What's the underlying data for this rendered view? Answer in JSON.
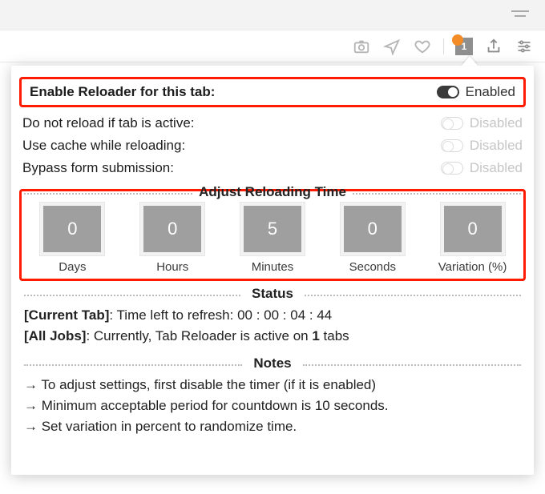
{
  "toolbar": {
    "badge_count": "1"
  },
  "options": {
    "enable_label": "Enable Reloader for this tab:",
    "enable_state": "Enabled",
    "no_reload_active_label": "Do not reload if tab is active:",
    "no_reload_active_state": "Disabled",
    "use_cache_label": "Use cache while reloading:",
    "use_cache_state": "Disabled",
    "bypass_form_label": "Bypass form submission:",
    "bypass_form_state": "Disabled"
  },
  "sections": {
    "adjust": "Adjust Reloading Time",
    "status": "Status",
    "notes": "Notes"
  },
  "time": {
    "days": {
      "value": "0",
      "label": "Days"
    },
    "hours": {
      "value": "0",
      "label": "Hours"
    },
    "minutes": {
      "value": "5",
      "label": "Minutes"
    },
    "seconds": {
      "value": "0",
      "label": "Seconds"
    },
    "variation": {
      "value": "0",
      "label": "Variation (%)"
    }
  },
  "status": {
    "current_prefix": "[Current Tab]",
    "current_text_a": ": Time left to refresh: ",
    "current_time": "00 : 00 : 04 : 44",
    "all_prefix": "[All Jobs]",
    "all_text_a": ": Currently, Tab Reloader is active on ",
    "all_count": "1",
    "all_text_b": " tabs"
  },
  "notes": {
    "n1": "→ To adjust settings, first disable the timer (if it is enabled)",
    "n2": "→ Minimum acceptable period for countdown is 10 seconds.",
    "n3": "→ Set variation in percent to randomize time."
  }
}
